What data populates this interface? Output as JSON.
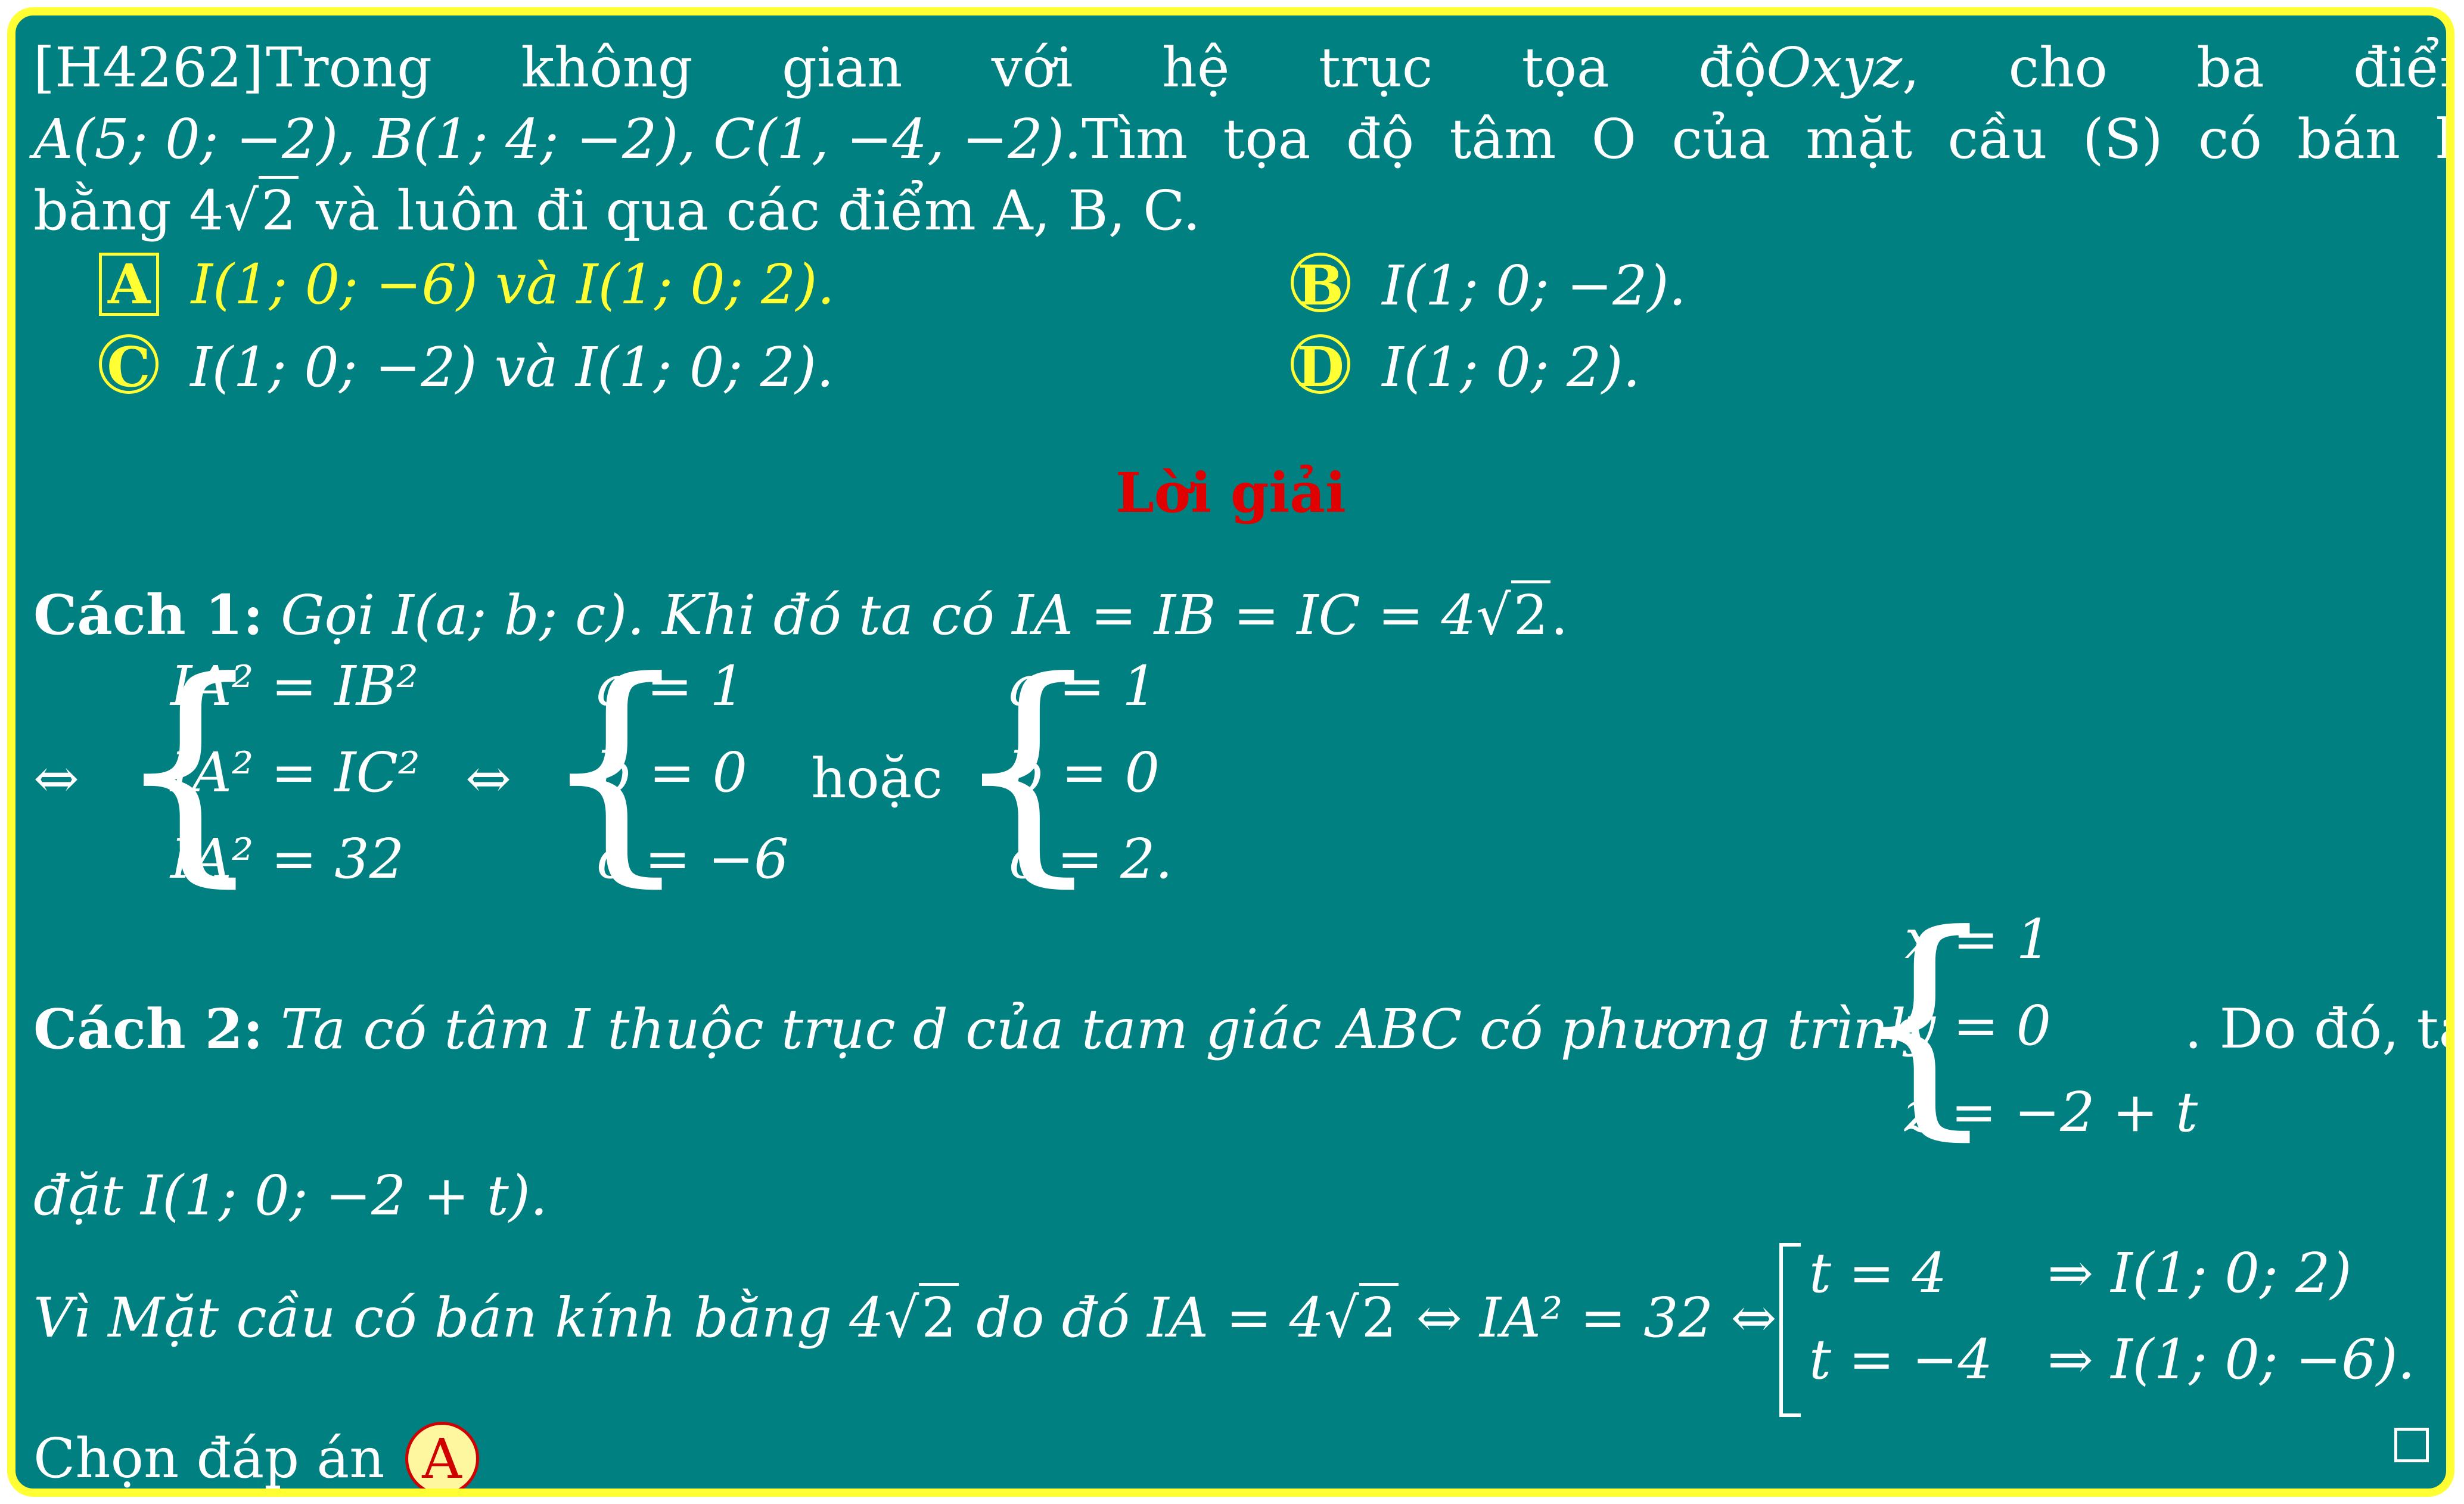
{
  "question": {
    "id": "[H4262]",
    "intro": "Trong không gian với hệ trục tọa độ",
    "coord_system": "Oxyz",
    "given_prefix": ", cho ba điểm",
    "points": "A(5; 0; −2), B(1; 4; −2), C(1, −4, −2).",
    "task": "Tìm tọa độ tâm O của mặt cầu (S) có bán kính",
    "radius_prefix": "bằng 4",
    "radius_rad": "2",
    "radius_suffix": "và luôn đi qua các điểm A, B, C."
  },
  "options": [
    {
      "label": "A",
      "text": "I(1; 0; −6) và I(1; 0; 2).",
      "highlighted": true
    },
    {
      "label": "B",
      "text": "I(1; 0; −2).",
      "highlighted": false
    },
    {
      "label": "C",
      "text": "I(1; 0; −2) và I(1; 0; 2).",
      "highlighted": false
    },
    {
      "label": "D",
      "text": "I(1; 0; 2).",
      "highlighted": false
    }
  ],
  "solution": {
    "title": "Lời giải",
    "method1": {
      "heading": "Cách 1:",
      "text": "Gọi I(a; b; c). Khi đó ta có IA = IB = IC = 4",
      "rad": "2",
      "tail": ".",
      "iff": "⇔",
      "sys1": [
        "IA² = IB²",
        "IA² = IC²",
        "IA² = 32"
      ],
      "sys2": [
        "a = 1",
        "b = 0",
        "c = −6"
      ],
      "or": "hoặc",
      "sys3": [
        "a = 1",
        "b = 0",
        "c = 2."
      ]
    },
    "method2": {
      "heading": "Cách 2:",
      "text": "Ta có tâm I thuộc trục d của tam giác ABC có phương trình",
      "sys": [
        "x = 1",
        "y = 0",
        "z = −2 + t"
      ],
      "after": ". Do đó, ta",
      "line2": "đặt I(1; 0; −2 + t).",
      "line3_prefix": "Vì Mặt cầu có bán kính bằng 4",
      "line3_rad": "2",
      "line3_mid": "do đó IA = 4",
      "line3_rad2": "2",
      "line3_end": "⇔ IA² = 32 ⇔",
      "cases": [
        {
          "cond": "t = 4",
          "result": "⇒ I(1; 0; 2)"
        },
        {
          "cond": "t = −4",
          "result": "⇒ I(1; 0; −6)."
        }
      ]
    },
    "answer_prefix": "Chọn đáp án",
    "answer": "A"
  },
  "colors": {
    "background": "#008080",
    "border": "#ffff33",
    "highlight": "#ffff33",
    "title": "#e00000",
    "text": "#ffffff"
  }
}
